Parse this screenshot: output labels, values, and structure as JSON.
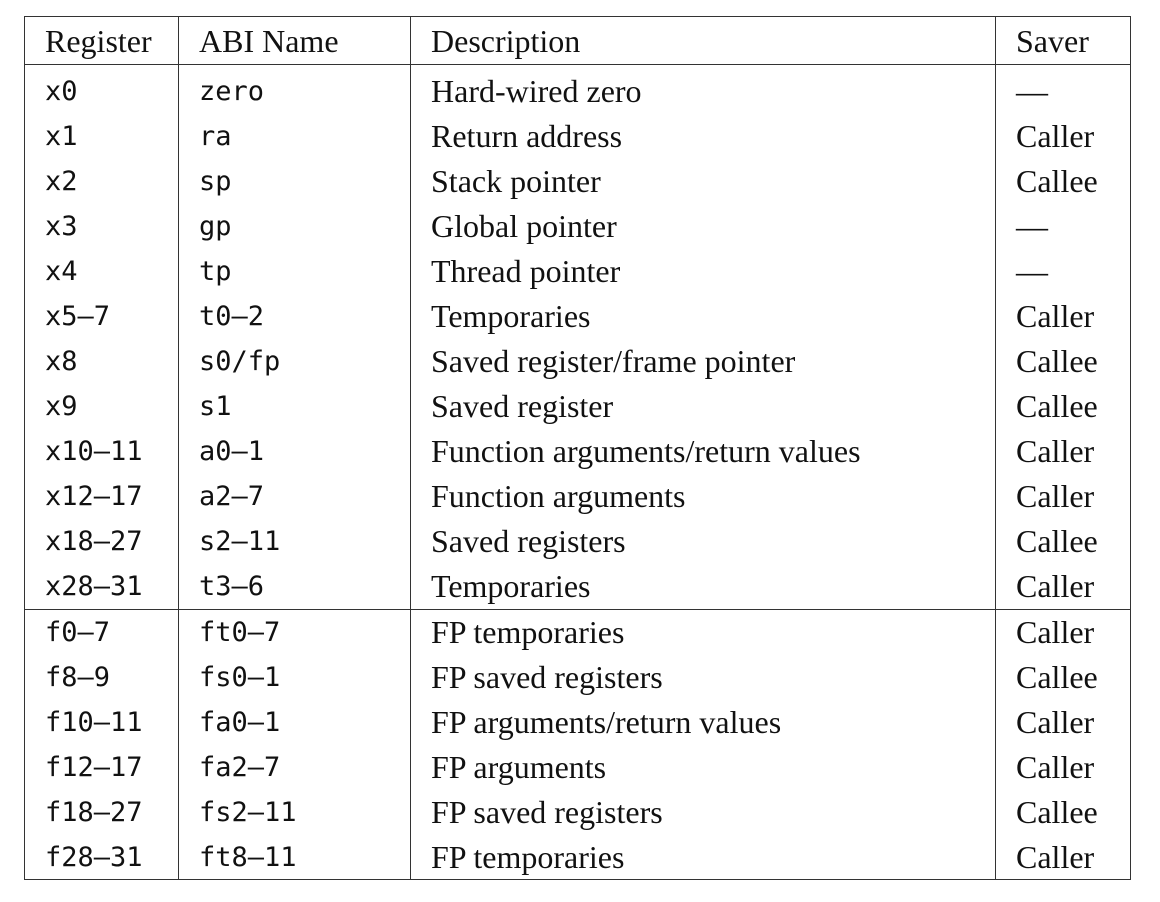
{
  "table": {
    "headers": [
      "Register",
      "ABI Name",
      "Description",
      "Saver"
    ],
    "integer_rows": [
      {
        "register": "x0",
        "abi": "zero",
        "description": "Hard-wired zero",
        "saver": "—"
      },
      {
        "register": "x1",
        "abi": "ra",
        "description": "Return address",
        "saver": "Caller"
      },
      {
        "register": "x2",
        "abi": "sp",
        "description": "Stack pointer",
        "saver": "Callee"
      },
      {
        "register": "x3",
        "abi": "gp",
        "description": "Global pointer",
        "saver": "—"
      },
      {
        "register": "x4",
        "abi": "tp",
        "description": "Thread pointer",
        "saver": "—"
      },
      {
        "register": "x5–7",
        "abi": "t0–2",
        "description": "Temporaries",
        "saver": "Caller"
      },
      {
        "register": "x8",
        "abi": "s0/fp",
        "description": "Saved register/frame pointer",
        "saver": "Callee"
      },
      {
        "register": "x9",
        "abi": "s1",
        "description": "Saved register",
        "saver": "Callee"
      },
      {
        "register": "x10–11",
        "abi": "a0–1",
        "description": "Function arguments/return values",
        "saver": "Caller"
      },
      {
        "register": "x12–17",
        "abi": "a2–7",
        "description": "Function arguments",
        "saver": "Caller"
      },
      {
        "register": "x18–27",
        "abi": "s2–11",
        "description": "Saved registers",
        "saver": "Callee"
      },
      {
        "register": "x28–31",
        "abi": "t3–6",
        "description": "Temporaries",
        "saver": "Caller"
      }
    ],
    "fp_rows": [
      {
        "register": "f0–7",
        "abi": "ft0–7",
        "description": "FP temporaries",
        "saver": "Caller"
      },
      {
        "register": "f8–9",
        "abi": "fs0–1",
        "description": "FP saved registers",
        "saver": "Callee"
      },
      {
        "register": "f10–11",
        "abi": "fa0–1",
        "description": "FP arguments/return values",
        "saver": "Caller"
      },
      {
        "register": "f12–17",
        "abi": "fa2–7",
        "description": "FP arguments",
        "saver": "Caller"
      },
      {
        "register": "f18–27",
        "abi": "fs2–11",
        "description": "FP saved registers",
        "saver": "Callee"
      },
      {
        "register": "f28–31",
        "abi": "ft8–11",
        "description": "FP temporaries",
        "saver": "Caller"
      }
    ]
  }
}
